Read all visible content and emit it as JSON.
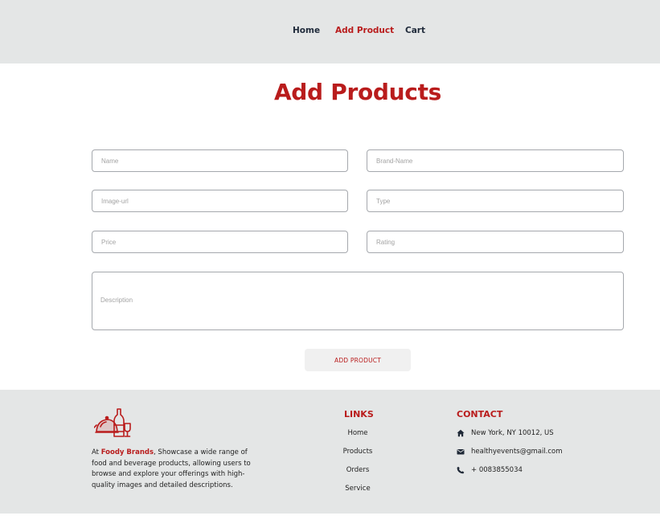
{
  "nav": {
    "home": "Home",
    "add_product": "Add Product",
    "cart": "Cart"
  },
  "page_title": "Add Products",
  "form": {
    "name_placeholder": "Name",
    "brand_placeholder": "Brand-Name",
    "image_placeholder": "Image-url",
    "type_placeholder": "Type",
    "price_placeholder": "Price",
    "rating_placeholder": "Rating",
    "description_placeholder": "Description",
    "submit_label": "ADD PRODUCT"
  },
  "footer": {
    "about_prefix": "At ",
    "about_brand": "Foody Brands",
    "about_text": ", Showcase a wide range of food and beverage products, allowing users to browse and explore your offerings with high-quality images and detailed descriptions.",
    "links_title": "LINKS",
    "links": [
      "Home",
      "Products",
      "Orders",
      "Service"
    ],
    "contact_title": "CONTACT",
    "address": "New York, NY 10012, US",
    "email": "healthyevents@gmail.com",
    "phone": "+ 0083855034"
  },
  "colors": {
    "accent": "#b91c1c",
    "bar_bg": "#e4e6e6"
  },
  "icons": {
    "logo": "food-platter-wine-logo",
    "address": "home-icon",
    "email": "envelope-icon",
    "phone": "phone-icon"
  }
}
